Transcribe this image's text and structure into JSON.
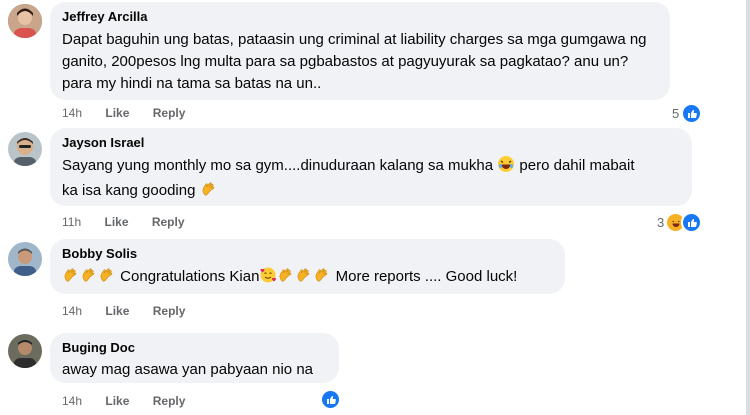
{
  "comments": [
    {
      "author": "Jeffrey Arcilla",
      "lines": [
        "Dapat baguhin ung batas, pataasin ung criminal at liability charges sa mga gumgawa ng",
        "ganito, 200pesos lng multa para sa pgbabastos at pagyuyurak sa pagkatao? anu un?",
        "para my hindi na tama sa batas na un.."
      ],
      "time": "14h",
      "like": "Like",
      "reply": "Reply",
      "reaction_count": "5",
      "reaction_icons": [
        "like-icon"
      ]
    },
    {
      "author": "Jayson Israel",
      "line1": "Sayang yung monthly mo sa gym....dinuduraan kalang sa mukha",
      "line1b": " pero dahil mabait",
      "line2": "ka isa kang gooding",
      "time": "11h",
      "like": "Like",
      "reply": "Reply",
      "reaction_count": "3",
      "reaction_icons": [
        "haha-icon",
        "like-icon"
      ]
    },
    {
      "author": "Bobby Solis",
      "text_a": "Congratulations Kian",
      "text_b": "More reports .... Good luck!",
      "time": "14h",
      "like": "Like",
      "reply": "Reply"
    },
    {
      "author": "Buging Doc",
      "text": "away mag asawa yan pabyaan nio na",
      "time": "14h",
      "like": "Like",
      "reply": "Reply",
      "reaction_icons": [
        "like-icon"
      ]
    }
  ],
  "colors": {
    "bubble": "#f0f2f5",
    "meta": "#65676b",
    "like_blue": "#1877f2",
    "haha_yellow": "#f7b125"
  }
}
